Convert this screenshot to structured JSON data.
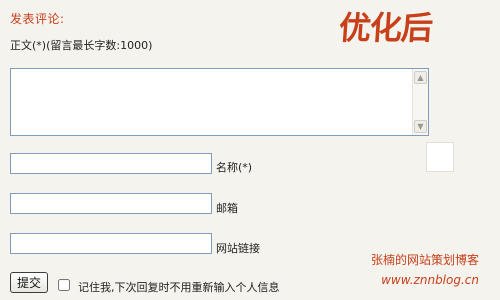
{
  "form": {
    "heading": "发表评论:",
    "body_label": "正文(*)(留言最长字数:1000)",
    "body_value": "",
    "name_value": "",
    "name_label": "名称(*)",
    "email_value": "",
    "email_label": "邮箱",
    "website_value": "",
    "website_label": "网站链接",
    "submit_label": "提交",
    "remember_checked": false,
    "remember_label": "记住我,下次回复时不用重新输入个人信息"
  },
  "badge": {
    "text": "优化后"
  },
  "watermark": {
    "author": "张楠的网站策划博客",
    "url": "www.znnblog.cn"
  },
  "colors": {
    "accent": "#c8401a",
    "field_border": "#7f9db9",
    "page_background": "#f4f3ee"
  },
  "icons": {
    "scroll_up": "scroll-up-arrow-icon",
    "scroll_down": "scroll-down-arrow-icon"
  }
}
